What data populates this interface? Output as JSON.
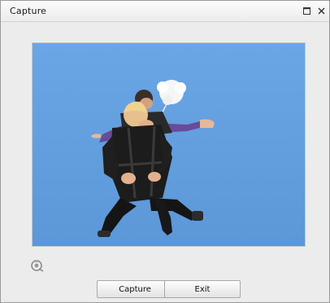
{
  "window": {
    "title": "Capture"
  },
  "titlebar": {
    "maximize_icon": "maximize-icon",
    "close_icon": "close-icon"
  },
  "preview": {
    "sky_color": "#69a3e2"
  },
  "buttons": {
    "capture_label": "Capture",
    "exit_label": "Exit"
  },
  "icons": {
    "camera": "camera-settings-icon"
  }
}
